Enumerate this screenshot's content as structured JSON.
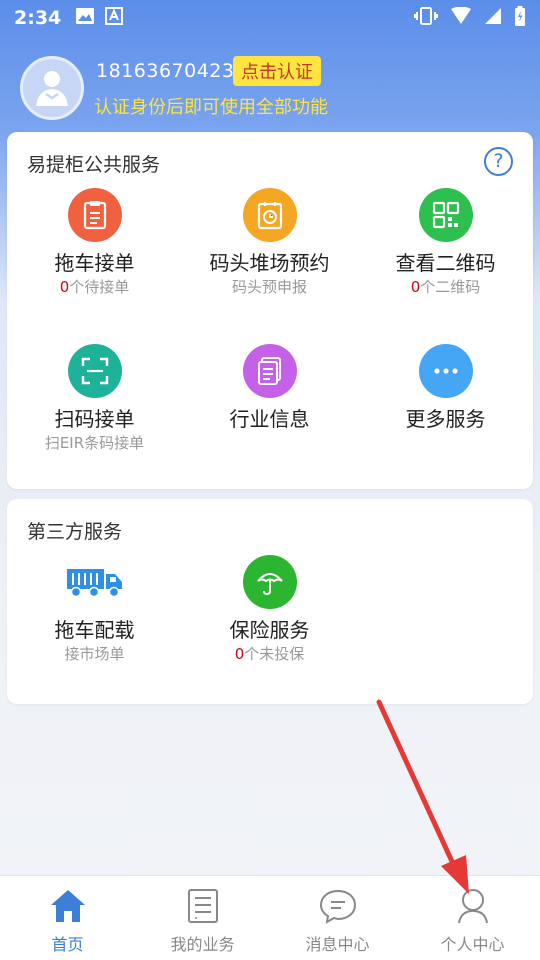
{
  "status_bar": {
    "time": "2:34"
  },
  "header": {
    "phone": "18163670423",
    "verify_label": "点击认证",
    "subtitle": "认证身份后即可使用全部功能"
  },
  "public_services": {
    "title": "易提柜公共服务",
    "items": [
      {
        "name": "拖车接单",
        "count": "0",
        "sub": "个待接单",
        "icon": "clipboard-icon",
        "color": "#f0623f"
      },
      {
        "name": "码头堆场预约",
        "count": "",
        "sub": "码头预申报",
        "icon": "calendar-clock-icon",
        "color": "#f5a623"
      },
      {
        "name": "查看二维码",
        "count": "0",
        "sub": "个二维码",
        "icon": "qrcode-icon",
        "color": "#2ec04f"
      },
      {
        "name": "扫码接单",
        "count": "",
        "sub": "扫EIR条码接单",
        "icon": "scan-icon",
        "color": "#1fb29b"
      },
      {
        "name": "行业信息",
        "count": "",
        "sub": "",
        "icon": "document-icon",
        "color": "#c561e8"
      },
      {
        "name": "更多服务",
        "count": "",
        "sub": "",
        "icon": "more-icon",
        "color": "#45a6f5"
      }
    ]
  },
  "third_party": {
    "title": "第三方服务",
    "items": [
      {
        "name": "拖车配载",
        "count": "",
        "sub": "接市场单",
        "icon": "truck-icon",
        "color": "#2f8fe8"
      },
      {
        "name": "保险服务",
        "count": "0",
        "sub": "个未投保",
        "icon": "umbrella-icon",
        "color": "#2bb531"
      }
    ]
  },
  "nav": [
    {
      "label": "首页",
      "icon": "home-icon",
      "active": true
    },
    {
      "label": "我的业务",
      "icon": "business-icon",
      "active": false
    },
    {
      "label": "消息中心",
      "icon": "message-icon",
      "active": false
    },
    {
      "label": "个人中心",
      "icon": "person-icon",
      "active": false
    }
  ],
  "colors": {
    "accent": "#3d7fd6",
    "verify_bg": "#fde541",
    "arrow": "#e53935"
  }
}
